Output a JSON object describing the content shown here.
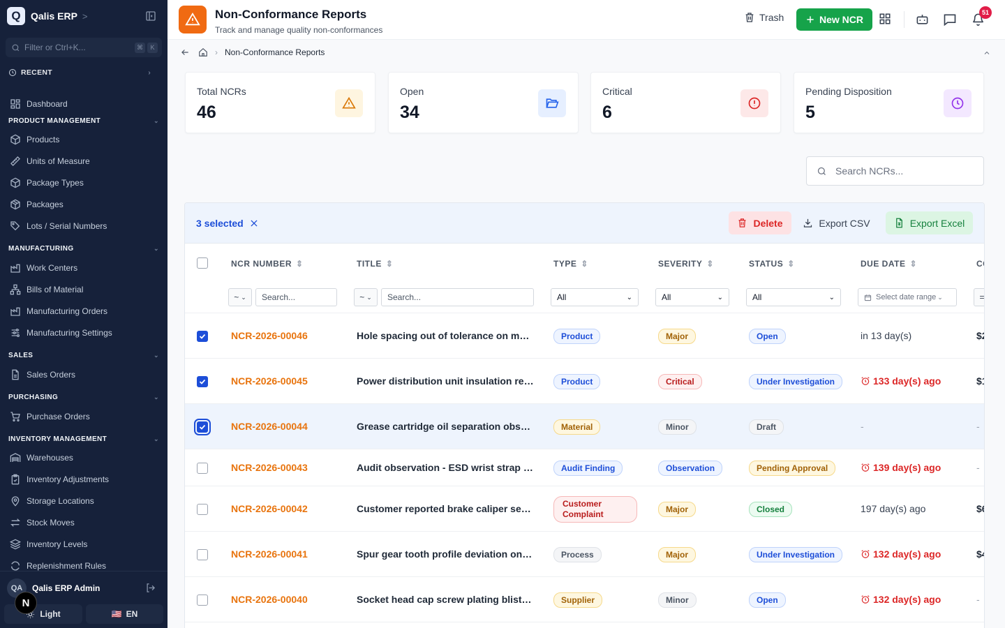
{
  "app": {
    "name": "Qalis ERP",
    "logo_letter": "Q"
  },
  "sidebar": {
    "filter_placeholder": "Filter or Ctrl+K...",
    "kbd": [
      "⌘",
      "K"
    ],
    "recent_label": "RECENT",
    "dashboard_label": "Dashboard",
    "sections": [
      {
        "title": "PRODUCT MANAGEMENT",
        "items": [
          "Products",
          "Units of Measure",
          "Package Types",
          "Packages",
          "Lots / Serial Numbers"
        ]
      },
      {
        "title": "MANUFACTURING",
        "items": [
          "Work Centers",
          "Bills of Material",
          "Manufacturing Orders",
          "Manufacturing Settings"
        ]
      },
      {
        "title": "SALES",
        "items": [
          "Sales Orders"
        ]
      },
      {
        "title": "PURCHASING",
        "items": [
          "Purchase Orders"
        ]
      },
      {
        "title": "INVENTORY MANAGEMENT",
        "items": [
          "Warehouses",
          "Inventory Adjustments",
          "Storage Locations",
          "Stock Moves",
          "Inventory Levels",
          "Replenishment Rules"
        ]
      }
    ],
    "user": {
      "initials": "QA",
      "name": "Qalis ERP Admin"
    },
    "theme_label": "Light",
    "lang_label": "EN",
    "lang_flag": "🇺🇸",
    "dev_badge": "N"
  },
  "header": {
    "title": "Non-Conformance Reports",
    "subtitle": "Track and manage quality non-conformances",
    "trash_label": "Trash",
    "new_label": "New NCR",
    "notification_count": "51"
  },
  "breadcrumb": {
    "current": "Non-Conformance Reports"
  },
  "stats": [
    {
      "label": "Total NCRs",
      "value": "46",
      "icon": "alert-triangle-icon",
      "color": "#d97706",
      "bg": "#fef5e0"
    },
    {
      "label": "Open",
      "value": "34",
      "icon": "folder-open-icon",
      "color": "#2563eb",
      "bg": "#e6efff"
    },
    {
      "label": "Critical",
      "value": "6",
      "icon": "alert-circle-icon",
      "color": "#dc2626",
      "bg": "#fde8e8"
    },
    {
      "label": "Pending Disposition",
      "value": "5",
      "icon": "clock-icon",
      "color": "#9333ea",
      "bg": "#f3e8ff"
    }
  ],
  "search": {
    "placeholder": "Search NCRs..."
  },
  "bulk": {
    "selected_label": "3 selected",
    "delete_label": "Delete",
    "export_csv_label": "Export CSV",
    "export_excel_label": "Export Excel"
  },
  "table": {
    "columns": [
      "NCR NUMBER",
      "TITLE",
      "TYPE",
      "SEVERITY",
      "STATUS",
      "DUE DATE",
      "CO"
    ],
    "filters": {
      "op": "~",
      "text_placeholder": "Search...",
      "select_all": "All",
      "date_placeholder": "Select date range",
      "cost_op": "="
    },
    "rows": [
      {
        "checked": true,
        "ncr": "NCR-2026-00046",
        "title": "Hole spacing out of tolerance on moun...",
        "type": "Product",
        "severity": "Major",
        "status": "Open",
        "due": "in 13 day(s)",
        "due_kind": "normal",
        "cost": "$2"
      },
      {
        "checked": true,
        "ncr": "NCR-2026-00045",
        "title": "Power distribution unit insulation resist...",
        "type": "Product",
        "severity": "Critical",
        "status": "Under Investigation",
        "due": "133 day(s) ago",
        "due_kind": "overdue",
        "cost": "$1"
      },
      {
        "checked": true,
        "ncr": "NCR-2026-00044",
        "title": "Grease cartridge oil separation observ...",
        "type": "Material",
        "severity": "Minor",
        "status": "Draft",
        "due": "-",
        "due_kind": "none",
        "cost": "-"
      },
      {
        "checked": false,
        "ncr": "NCR-2026-00043",
        "title": "Audit observation - ESD wrist strap lo...",
        "type": "Audit Finding",
        "severity": "Observation",
        "status": "Pending Approval",
        "due": "139 day(s) ago",
        "due_kind": "overdue",
        "cost": "-"
      },
      {
        "checked": false,
        "ncr": "NCR-2026-00042",
        "title": "Customer reported brake caliper seal ...",
        "type": "Customer Complaint",
        "severity": "Major",
        "status": "Closed",
        "due": "197 day(s) ago",
        "due_kind": "normal",
        "cost": "$6"
      },
      {
        "checked": false,
        "ncr": "NCR-2026-00041",
        "title": "Spur gear tooth profile deviation on in...",
        "type": "Process",
        "severity": "Major",
        "status": "Under Investigation",
        "due": "132 day(s) ago",
        "due_kind": "overdue",
        "cost": "$4"
      },
      {
        "checked": false,
        "ncr": "NCR-2026-00040",
        "title": "Socket head cap screw plating blistering",
        "type": "Supplier",
        "severity": "Minor",
        "status": "Open",
        "due": "132 day(s) ago",
        "due_kind": "overdue",
        "cost": "-"
      }
    ]
  },
  "colors": {
    "type": {
      "Product": "blue",
      "Material": "amber",
      "Audit Finding": "blue",
      "Customer Complaint": "red",
      "Process": "gray",
      "Supplier": "amber"
    },
    "severity": {
      "Major": "amber",
      "Critical": "red",
      "Minor": "gray",
      "Observation": "blue"
    },
    "status": {
      "Open": "blue",
      "Under Investigation": "blue",
      "Draft": "gray",
      "Pending Approval": "amber",
      "Closed": "green"
    }
  }
}
